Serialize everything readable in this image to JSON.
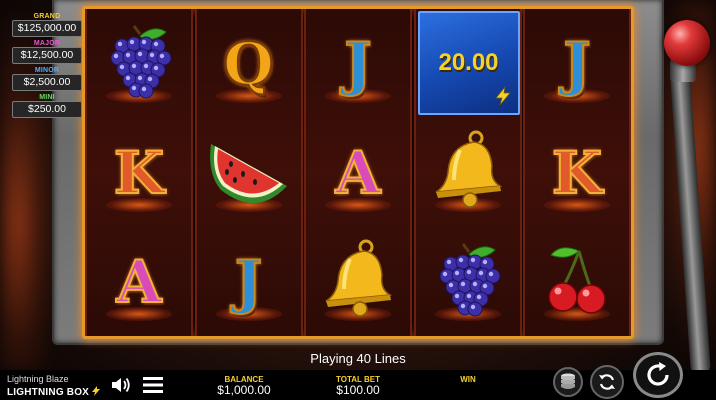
{
  "jackpots": [
    {
      "label": "GRAND",
      "value": "$125,000.00",
      "color": "#f6d12a"
    },
    {
      "label": "MAJOR",
      "value": "$12,500.00",
      "color": "#e85ad0"
    },
    {
      "label": "MINOR",
      "value": "$2,500.00",
      "color": "#4fb0ff"
    },
    {
      "label": "MINI",
      "value": "$250.00",
      "color": "#5fe05f"
    }
  ],
  "reels": [
    [
      "grapes",
      "K",
      "A"
    ],
    [
      "Q",
      "watermelon",
      "J"
    ],
    [
      "J",
      "A",
      "bell"
    ],
    [
      "bonus",
      "bell",
      "grapes"
    ],
    [
      "J",
      "K",
      "cherries"
    ]
  ],
  "bonus": {
    "value": "20.00",
    "icon": "lightning-bolt-icon"
  },
  "status": {
    "lines_text": "Playing 40 Lines"
  },
  "footer": {
    "game_title": "Lightning Blaze",
    "brand": "LIGHTNING BOX",
    "balance_label": "BALANCE",
    "balance_value": "$1,000.00",
    "total_bet_label": "TOTAL BET",
    "total_bet_value": "$100.00",
    "win_label": "WIN",
    "win_value": ""
  },
  "controls": {
    "sound_icon": "speaker-icon",
    "menu_icon": "hamburger-menu-icon",
    "bet_icon": "coin-stack-icon",
    "autoplay_icon": "autoplay-icon",
    "spin_icon": "spin-icon"
  },
  "colors": {
    "accent": "#f6d12a",
    "frame_glow": "#ff8a1a",
    "bonus_blue": "#1548b0"
  }
}
